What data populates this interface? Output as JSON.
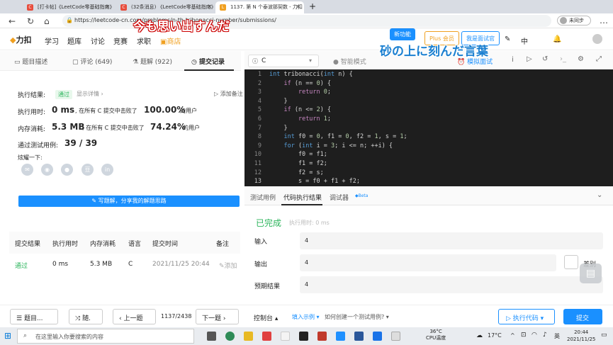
{
  "browser": {
    "tabs": [
      {
        "label": "[打卡帖]《LeetCode零基础指南》"
      },
      {
        "label": "(32条消息) 《LeetCode零基础指南》"
      },
      {
        "label": "1137. 第 N 个泰波那契数 - 力扣"
      }
    ],
    "url": "https://leetcode-cn.com/problems/n-th-tribonacci-number/submissions/",
    "profile_label": "未同步"
  },
  "overlays": {
    "top": "今も思い出すんだ",
    "right": "砂の上に刻んだ言葉"
  },
  "site": {
    "logo": "力扣",
    "nav": [
      "学习",
      "题库",
      "讨论",
      "竞赛",
      "求职",
      "商店"
    ],
    "new_feature": "新功能",
    "plus": "Plus 会员",
    "interviewer": "我是面试官",
    "lang": "中"
  },
  "left_tabs": [
    "题目描述",
    "评论 (649)",
    "题解 (922)",
    "提交记录"
  ],
  "result": {
    "label": "执行结果:",
    "status": "通过",
    "details": "显示详情 ›",
    "add_note": "添加备注",
    "time_label": "执行用时:",
    "time": "0 ms",
    "time_text": ", 在所有 C 提交中击败了",
    "time_pct": "100.00%",
    "users": "的用户",
    "mem_label": "内存消耗:",
    "mem": "5.3 MB",
    "mem_text": ", 在所有 C 提交中击败了",
    "mem_pct": "74.24%",
    "tests_label": "通过测试用例:",
    "tests": "39 / 39",
    "share": "炫耀一下:",
    "write_btn": "写题解，分享我的解题思路"
  },
  "table": {
    "headers": [
      "提交结果",
      "执行用时",
      "内存消耗",
      "语言",
      "提交时间",
      "备注"
    ],
    "row": {
      "result": "通过",
      "time": "0 ms",
      "mem": "5.3 MB",
      "lang": "C",
      "date": "2021/11/25 20:44",
      "note": "添加"
    }
  },
  "editor": {
    "lang": "C",
    "mode": "智能模式",
    "mock": "模拟面试",
    "lines": [
      {
        "n": "1",
        "t": "int tribonacci(int n) {"
      },
      {
        "n": "2",
        "t": "    if (n == 0) {"
      },
      {
        "n": "3",
        "t": "        return 0;"
      },
      {
        "n": "4",
        "t": "    }"
      },
      {
        "n": "5",
        "t": "    if (n <= 2) {"
      },
      {
        "n": "6",
        "t": "        return 1;"
      },
      {
        "n": "7",
        "t": "    }"
      },
      {
        "n": "8",
        "t": "    int f0 = 0, f1 = 0, f2 = 1, s = 1;"
      },
      {
        "n": "9",
        "t": "    for (int i = 3; i <= n; ++i) {"
      },
      {
        "n": "10",
        "t": "        f0 = f1;"
      },
      {
        "n": "11",
        "t": "        f1 = f2;"
      },
      {
        "n": "12",
        "t": "        f2 = s;"
      },
      {
        "n": "13",
        "t": "        s = f0 + f1 + f2;"
      }
    ]
  },
  "console": {
    "tabs": [
      "测试用例",
      "代码执行结果",
      "调试器"
    ],
    "beta": "Beta",
    "status": "已完成",
    "exec_time": "执行用时: 0 ms",
    "input_label": "输入",
    "input": "4",
    "output_label": "输出",
    "output": "4",
    "diff": "差别",
    "expected_label": "预期结果",
    "expected": "4"
  },
  "bottom": {
    "problems": "题目...",
    "random": "随.",
    "prev": "上一题",
    "page": "1137/2438",
    "next": "下一题",
    "console": "控制台",
    "fill_example": "填入示例",
    "how_test": "如何创建一个测试用例?",
    "run": "执行代码",
    "submit": "提交"
  },
  "taskbar": {
    "search_placeholder": "在这里输入你要搜索的内容",
    "cpu_temp": "36°C",
    "cpu_label": "CPU温度",
    "weather": "17°C",
    "ime": "英",
    "time": "20:44",
    "date": "2021/11/25"
  },
  "colors": {
    "accent": "#1a90ff",
    "pass": "#2db55d",
    "editor_bg": "#1e1e1e"
  }
}
